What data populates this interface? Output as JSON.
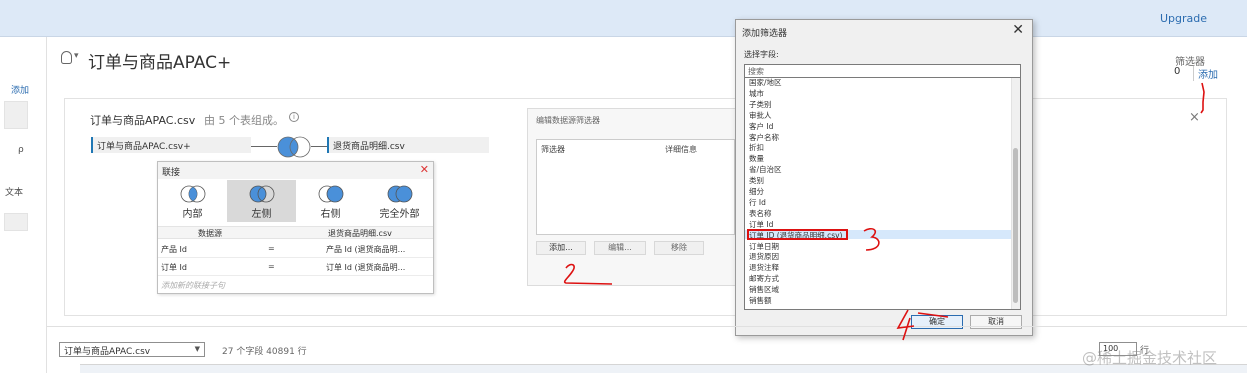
{
  "topbar": {
    "upgrade_label": "Upgrade"
  },
  "leftbar": {
    "add_label": "添加",
    "search_glyph": "ρ",
    "text_label": "文本"
  },
  "header": {
    "title": "订单与商品APAC+",
    "caret": "▾"
  },
  "filters": {
    "label": "筛选器",
    "count": "0",
    "add_label": "添加"
  },
  "connection": {
    "title": "订单与商品APAC.csv",
    "subtitle": "由 5 个表组成。",
    "info_glyph": "i",
    "left_table": "订单与商品APAC.csv+",
    "right_table": "退货商品明细.csv",
    "panel_close": "×"
  },
  "join_dialog": {
    "title": "联接",
    "close": "✕",
    "types": [
      {
        "label": "内部"
      },
      {
        "label": "左侧"
      },
      {
        "label": "右侧"
      },
      {
        "label": "完全外部"
      }
    ],
    "selected_type": "左侧",
    "grid_headers": [
      "数据源",
      "退货商品明细.csv"
    ],
    "rows": [
      {
        "left": "产品 Id",
        "op": "=",
        "right": "产品 Id (退货商品明..."
      },
      {
        "left": "订单 Id",
        "op": "=",
        "right": "订单 Id (退货商品明..."
      }
    ],
    "add_clause": "添加新的联接子句"
  },
  "edit_panel": {
    "title": "编辑数据源筛选器",
    "headers": [
      "筛选器",
      "详细信息"
    ],
    "buttons": [
      "添加...",
      "编辑...",
      "移除"
    ]
  },
  "add_filter_dialog": {
    "title": "添加筛选器",
    "close": "✕",
    "field_label": "选择字段:",
    "search_placeholder": "搜索",
    "fields": [
      "国家/地区",
      "城市",
      "子类别",
      "审批人",
      "客户 Id",
      "客户名称",
      "折扣",
      "数量",
      "省/自治区",
      "类别",
      "细分",
      "行 Id",
      "表名称",
      "订单 Id",
      "订单 ID (退货商品明细.csv)",
      "订单日期",
      "退货原因",
      "退货注释",
      "邮寄方式",
      "销售区域",
      "销售额"
    ],
    "selected_field": "订单 ID (退货商品明细.csv)",
    "ok_label": "确定",
    "cancel_label": "取消"
  },
  "bottom": {
    "table_select_value": "订单与商品APAC.csv",
    "caret": "▼",
    "field_count": "27 个字段 40891 行",
    "rows_value": "100",
    "rows_label": "行"
  },
  "annotations": [
    "1",
    "2",
    "3",
    "4"
  ],
  "watermark": "@稀土掘金技术社区",
  "colors": {
    "accent": "#2b6cb0",
    "highlight_box": "#dd1111",
    "topbar": "#dde9f7",
    "join_blue": "#4a90d9"
  }
}
